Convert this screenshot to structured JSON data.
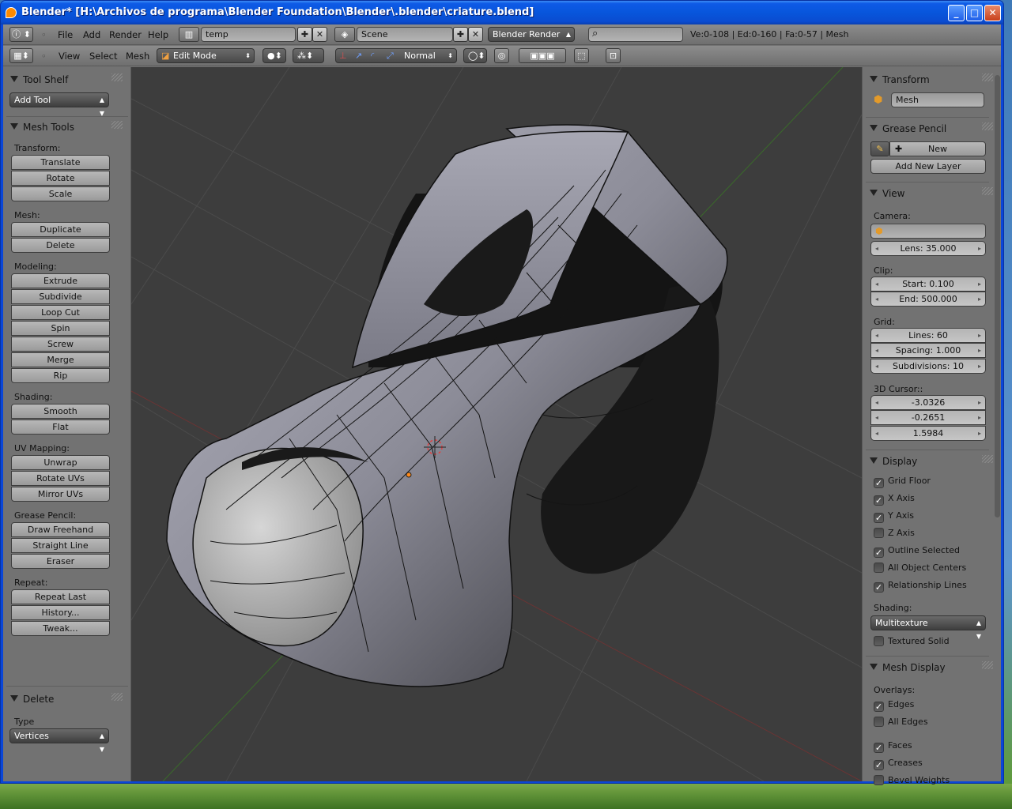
{
  "window": {
    "title": "Blender* [H:\\Archivos de programa\\Blender Foundation\\Blender\\.blender\\criature.blend]",
    "controls": {
      "minimize": "_",
      "maximize": "□",
      "close": "✕"
    }
  },
  "top_header": {
    "info_icon": "info-icon",
    "menus": [
      "File",
      "Add",
      "Render",
      "Help"
    ],
    "screen_field": "temp",
    "scene_field": "Scene",
    "render_engine": "Blender Render",
    "search_placeholder": "",
    "stats": "Ve:0-108 | Ed:0-160 | Fa:0-57 | Mesh"
  },
  "view_header": {
    "menus": [
      "View",
      "Select",
      "Mesh"
    ],
    "mode": "Edit Mode",
    "orientation": "Normal"
  },
  "tool_shelf": {
    "title": "Tool Shelf",
    "add_tool": "Add Tool",
    "mesh_tools_title": "Mesh Tools",
    "sections": [
      {
        "label": "Transform:",
        "buttons": [
          "Translate",
          "Rotate",
          "Scale"
        ]
      },
      {
        "label": "Mesh:",
        "buttons": [
          "Duplicate",
          "Delete"
        ]
      },
      {
        "label": "Modeling:",
        "buttons": [
          "Extrude",
          "Subdivide",
          "Loop Cut",
          "Spin",
          "Screw",
          "Merge",
          "Rip"
        ]
      },
      {
        "label": "Shading:",
        "buttons": [
          "Smooth",
          "Flat"
        ]
      },
      {
        "label": "UV Mapping:",
        "buttons": [
          "Unwrap",
          "Rotate UVs",
          "Mirror UVs"
        ]
      },
      {
        "label": "Grease Pencil:",
        "buttons": [
          "Draw Freehand",
          "Straight Line",
          "Eraser"
        ]
      },
      {
        "label": "Repeat:",
        "buttons": [
          "Repeat Last",
          "History...",
          "Tweak..."
        ]
      }
    ],
    "operator": {
      "title": "Delete",
      "type_label": "Type",
      "type_value": "Vertices"
    }
  },
  "properties": {
    "transform": {
      "title": "Transform",
      "object_name": "Mesh"
    },
    "grease_pencil": {
      "title": "Grease Pencil",
      "new": "New",
      "add_layer": "Add New Layer"
    },
    "view": {
      "title": "View",
      "camera_label": "Camera:",
      "lens": "Lens: 35.000",
      "clip_label": "Clip:",
      "clip_start": "Start: 0.100",
      "clip_end": "End: 500.000",
      "grid_label": "Grid:",
      "grid_lines": "Lines: 60",
      "grid_spacing": "Spacing: 1.000",
      "grid_subdiv": "Subdivisions: 10",
      "cursor_label": "3D Cursor::",
      "cursor_x": "-3.0326",
      "cursor_y": "-0.2651",
      "cursor_z": "1.5984"
    },
    "display": {
      "title": "Display",
      "options": [
        {
          "label": "Grid Floor",
          "checked": true
        },
        {
          "label": "X Axis",
          "checked": true
        },
        {
          "label": "Y Axis",
          "checked": true
        },
        {
          "label": "Z Axis",
          "checked": false
        },
        {
          "label": "Outline Selected",
          "checked": true
        },
        {
          "label": "All Object Centers",
          "checked": false
        },
        {
          "label": "Relationship Lines",
          "checked": true
        }
      ],
      "shading_label": "Shading:",
      "shading_value": "Multitexture",
      "textured_solid": "Textured Solid"
    },
    "mesh_display": {
      "title": "Mesh Display",
      "overlays_label": "Overlays:",
      "options": [
        {
          "label": "Edges",
          "checked": true
        },
        {
          "label": "All Edges",
          "checked": false
        },
        {
          "label": "Faces",
          "checked": true
        },
        {
          "label": "Creases",
          "checked": true
        },
        {
          "label": "Bevel Weights",
          "checked": false
        }
      ]
    }
  },
  "colors": {
    "viewport_bg": "#3d3d3d",
    "panel_bg": "#727272",
    "x_axis": "#8a3a3a",
    "y_axis": "#3a8a2a",
    "selected_vertex": "#ff8a1a"
  }
}
